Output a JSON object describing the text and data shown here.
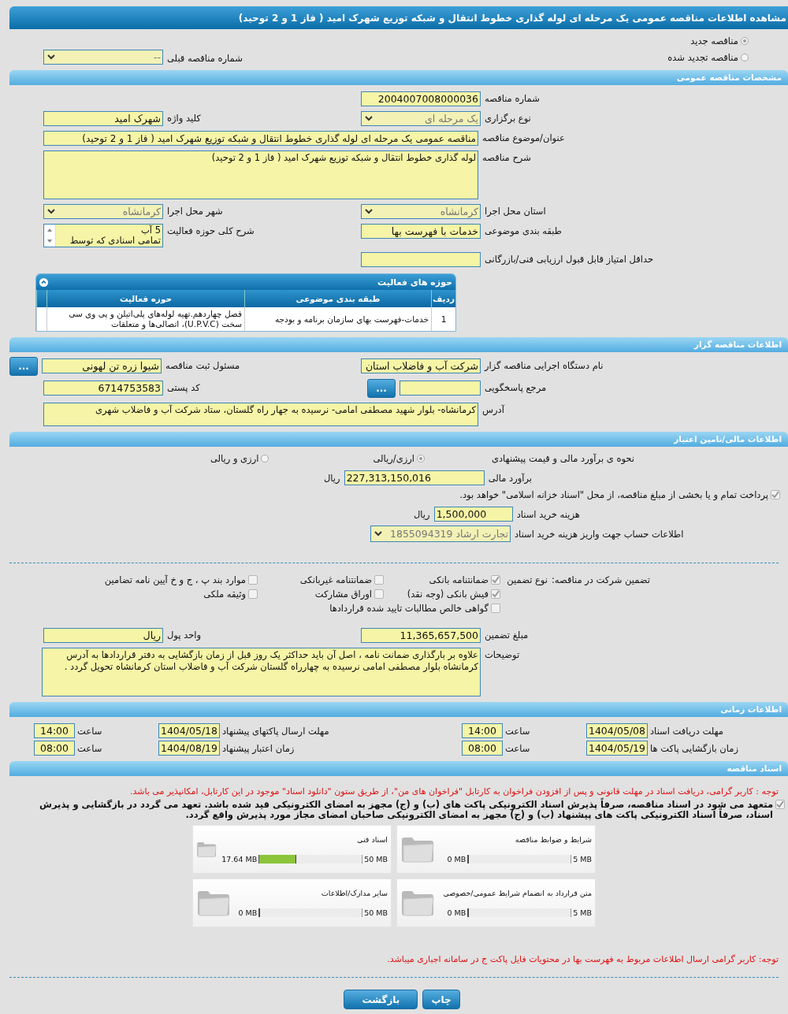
{
  "title": "مشاهده اطلاعات مناقصه عمومی یک مرحله ای لوله گذاری خطوط انتقال و شبکه توزیع شهرک امید ( فاز 1 و 2 توحید)",
  "tender_type": {
    "options": [
      {
        "label": "مناقصه جدید",
        "selected": true
      },
      {
        "label": "مناقصه تجدید شده",
        "selected": false
      }
    ],
    "previous": {
      "label": "شماره مناقصه قبلی",
      "value": "--",
      "kind": "select"
    }
  },
  "sections": [
    {
      "kind": "form",
      "header": "مشخصات مناقصه عمومی",
      "rows": [
        {
          "fields": [
            {
              "label": "شماره مناقصه",
              "value": "2004007008000036",
              "kind": "text"
            }
          ]
        },
        {
          "fields": [
            {
              "label": "نوع برگزاری",
              "value": "یک مرحله ای",
              "kind": "select"
            },
            {
              "label": "کلید واژه",
              "value": "شهرک امید",
              "kind": "text"
            }
          ]
        },
        {
          "fields": [
            {
              "label": "عنوان/موضوع مناقصه",
              "value": "مناقصه عمومی یک مرحله ای لوله گذاری خطوط انتقال و شبکه توزیع شهرک امید ( فاز 1 و 2 توحید)",
              "kind": "wide"
            }
          ]
        },
        {
          "fields": [
            {
              "label": "شرح مناقصه",
              "value": "لوله گذاری خطوط انتقال و شبکه توزیع شهرک امید ( فاز 1 و 2 توحید)",
              "kind": "area"
            }
          ]
        },
        {
          "fields": [
            {
              "label": "استان محل اجرا",
              "value": "کرمانشاه",
              "kind": "select"
            },
            {
              "label": "شهر محل اجرا",
              "value": "کرمانشاه",
              "kind": "select"
            }
          ]
        },
        {
          "fields": [
            {
              "label": "طبقه بندی موضوعی",
              "value": "خدمات با فهرست بها",
              "kind": "text"
            },
            {
              "label": "شرح کلی حوزه فعالیت",
              "value": "5 آب\nتمامی اسنادی که توسط",
              "kind": "scroll"
            }
          ]
        },
        {
          "fields": [
            {
              "label": "حداقل امتیاز قابل قبول ارزیابی فنی/بازرگانی",
              "kind": "text"
            }
          ]
        }
      ],
      "activity_table": {
        "title": "حوزه های فعالیت",
        "columns": [
          "ردیف",
          "طبقه بندی موضوعی",
          "حوزه فعالیت"
        ],
        "rows": [
          [
            "1",
            "خدمات-فهرست بهای سازمان برنامه و بودجه",
            "فصل چهاردهم.تهیه لوله‌های پلی‌اتیلن و پی وی سی سخت (U.P.V.C)، اتصالی‌ها و متعلقات"
          ]
        ]
      }
    },
    {
      "kind": "form",
      "header": "اطلاعات مناقصه گزار",
      "rows": [
        {
          "fields": [
            {
              "label": "نام دستگاه اجرایی مناقصه گزار",
              "value": "شرکت آب و فاضلاب استان",
              "kind": "text"
            },
            {
              "label": "مسئول ثبت مناقصه",
              "value": "شیوا زره تن لهونی",
              "kind": "text",
              "button": "..."
            }
          ]
        },
        {
          "fields": [
            {
              "label": "مرجع پاسخگویی",
              "kind": "text",
              "button": "..."
            },
            {
              "label": "کد پستی",
              "value": "6714753583",
              "kind": "text"
            }
          ]
        },
        {
          "fields": [
            {
              "label": "آدرس",
              "value": "کرمانشاه- بلوار شهید مصطفی امامی- نرسیده به جهار راه گلستان، ستاد شرکت  آب و فاضلاب شهری",
              "kind": "area-short"
            }
          ]
        }
      ]
    },
    {
      "kind": "finance",
      "header": "اطلاعات مالی/تامین اعتبار",
      "estimate_method": {
        "label": "نحوه ی برآورد مالی و قیمت پیشنهادی",
        "options": [
          {
            "label": "ارزی/ریالی",
            "selected": true
          },
          {
            "label": "ارزی و ریالی",
            "selected": false
          }
        ]
      },
      "estimate": {
        "label": "برآورد مالی",
        "value": "227,313,150,016",
        "unit": "ریال"
      },
      "payment_note": {
        "label": "پرداخت تمام و یا بخشی از مبلغ مناقصه، از محل \"اسناد خزانه اسلامی\" خواهد بود.",
        "checked": true
      },
      "fee": {
        "label": "هزینه خرید اسناد",
        "value": "1,500,000",
        "unit": "ریال"
      },
      "account": {
        "label": "اطلاعات حساب جهت واریز هزینه خرید اسناد",
        "value": "تجارت ارشاد 1855094319"
      },
      "guarantee": {
        "label": "تضمین شرکت در مناقصه:",
        "type_label": "نوع تضمین",
        "options": [
          {
            "label": "ضمانتنامه بانکی",
            "checked": true
          },
          {
            "label": "ضمانتنامه غیربانکی",
            "checked": false
          },
          {
            "label": "موارد بند پ ، ج و خ آیین نامه تضامین",
            "checked": false
          },
          {
            "label": "فیش بانکی (وجه نقد)",
            "checked": true
          },
          {
            "label": "اوراق مشارکت",
            "checked": false
          },
          {
            "label": "وثیقه ملکی",
            "checked": false
          },
          {
            "label": "گواهی خالص مطالبات تایید شده قراردادها",
            "checked": false
          }
        ]
      },
      "rows": [
        {
          "fields": [
            {
              "label": "مبلغ تضمین",
              "value": "11,365,657,500",
              "kind": "text"
            },
            {
              "label": "واحد پول",
              "value": "ریال",
              "kind": "text"
            }
          ]
        },
        {
          "fields": [
            {
              "label": "توضیحات",
              "value": "علاوه بر بارگذاری ضمانت نامه ، اصل آن باید حداکثر یک روز قبل از زمان بازگشایی به دفتر قراردادها به آدرس کرمانشاه بلوار مصطفی امامی نرسیده به چهارراه گلستان شرکت آب و فاضلاب استان کرمانشاه تحویل گردد .",
              "kind": "area"
            }
          ]
        }
      ]
    },
    {
      "kind": "times",
      "header": "اطلاعات زمانی",
      "items": [
        {
          "label": "مهلت دریافت اسناد",
          "date": "1404/05/08",
          "time_label": "ساعت",
          "time": "14:00"
        },
        {
          "label": "مهلت ارسال پاکتهای پیشنهاد",
          "date": "1404/05/18",
          "time_label": "ساعت",
          "time": "14:00"
        },
        {
          "label": "زمان بازگشایی پاکت ها",
          "date": "1404/05/19",
          "time_label": "ساعت",
          "time": "08:00"
        },
        {
          "label": "زمان اعتبار پیشنهاد",
          "date": "1404/08/19",
          "time_label": "ساعت",
          "time": "08:00"
        }
      ]
    },
    {
      "kind": "documents",
      "header": "اسناد مناقصه",
      "notice": "توجه : کاربر گرامی، دریافت اسناد در مهلت قانونی و پس از افزودن فراخوان به کارتابل \"فراخوان های من\"، از طریق ستون \"دانلود اسناد\" موجود در این کارتابل، امکانپذیر می باشد.",
      "commitment": {
        "label": "متعهد می شود در اسناد مناقصه، صرفاً پذیرش اسناد الکترونیکی پاکت های (ب) و (ج) مجهز به امضای الکترونیکی قید شده باشد. تعهد می گردد در بازگشایی و پذیرش اسناد، صرفاً اسناد الکترونیکی پاکت های پیشنهاد (ب) و (ج) مجهز به امضای الکترونیکی صاحبان امضای مجاز مورد پذیرش واقع گردد.",
        "checked": true
      },
      "files": [
        {
          "name": "شرایط و ضوابط مناقصه",
          "size": "0 MB",
          "max": "5 MB",
          "level": 0
        },
        {
          "name": "اسناد فنی",
          "size": "17.64 MB",
          "max": "50 MB",
          "level": 0.35
        },
        {
          "name": "متن قرارداد به انضمام شرایط عمومی/خصوصی",
          "size": "0 MB",
          "max": "5 MB",
          "level": 0
        },
        {
          "name": "سایر مدارک/اطلاعات",
          "size": "0 MB",
          "max": "50 MB",
          "level": 0
        }
      ],
      "note": "توجه: کاربر گرامی ارسال اطلاعات مربوط به فهرست بها در محتویات فایل پاکت ج در سامانه اجباری میباشد."
    }
  ],
  "buttons": [
    {
      "label": "چاپ"
    },
    {
      "label": "بازگشت"
    }
  ]
}
